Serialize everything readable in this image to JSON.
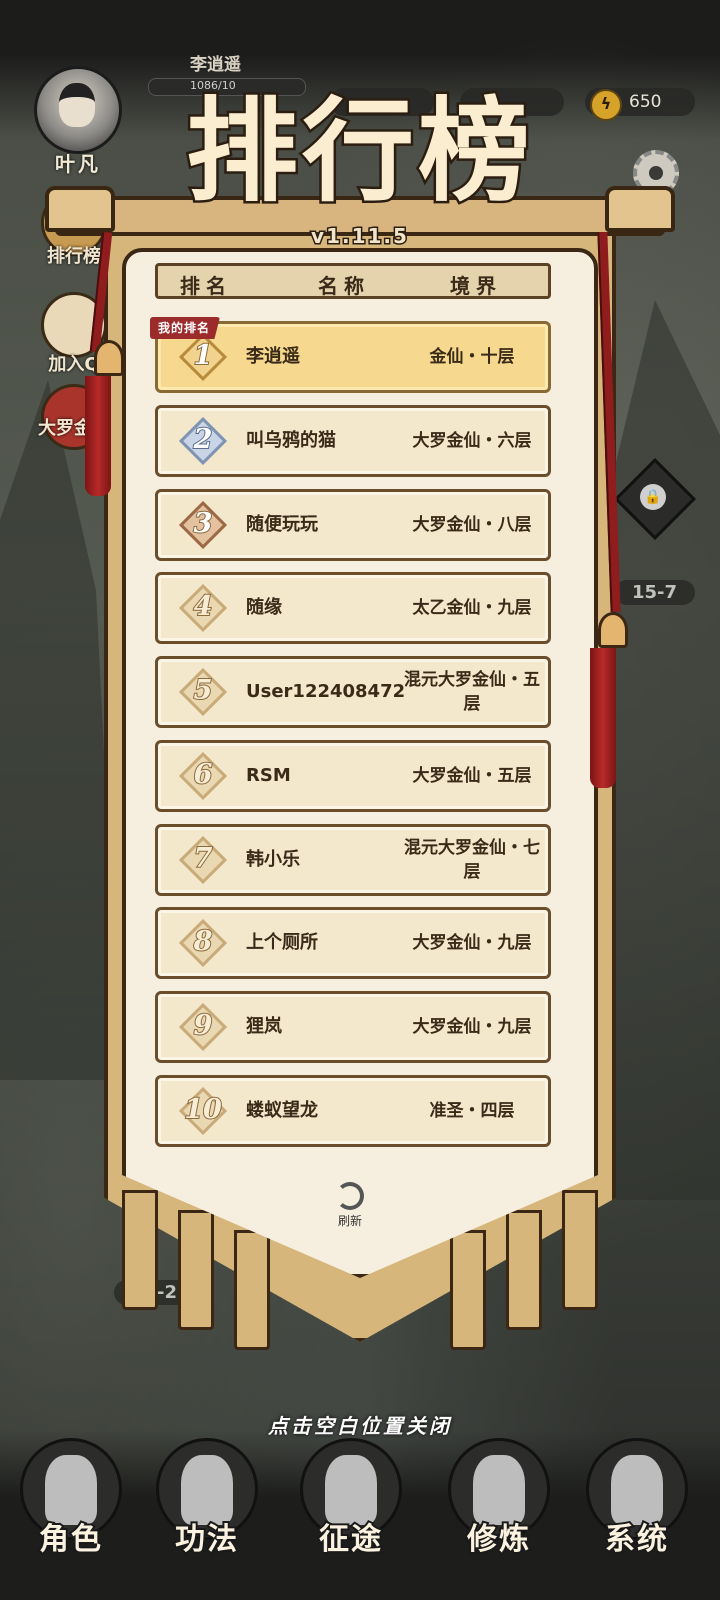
{
  "player": {
    "avatar_name": "叶凡",
    "name": "李逍遥",
    "exp_text": "1086/10",
    "energy": "650"
  },
  "side_buttons": [
    "排行榜",
    "加入Q",
    "大罗金礼"
  ],
  "stages": {
    "right": "15-7",
    "left": "15-2"
  },
  "leaderboard": {
    "title": "排行榜",
    "version": "v1.11.5",
    "headers": {
      "rank": "排名",
      "name": "名称",
      "realm": "境界"
    },
    "my_rank_tag": "我的排名",
    "my_row": {
      "rank": "1",
      "name": "李逍遥",
      "realm": "金仙・十层"
    },
    "rows": [
      {
        "rank": "2",
        "name": "叫乌鸦的猫",
        "realm": "大罗金仙・六层"
      },
      {
        "rank": "3",
        "name": "随便玩玩",
        "realm": "大罗金仙・八层"
      },
      {
        "rank": "4",
        "name": "随缘",
        "realm": "太乙金仙・九层"
      },
      {
        "rank": "5",
        "name": "User122408472",
        "realm": "混元大罗金仙・五层"
      },
      {
        "rank": "6",
        "name": "RSM",
        "realm": "大罗金仙・五层"
      },
      {
        "rank": "7",
        "name": "韩小乐",
        "realm": "混元大罗金仙・七层"
      },
      {
        "rank": "8",
        "name": "上个厕所",
        "realm": "大罗金仙・九层"
      },
      {
        "rank": "9",
        "name": "狸岚",
        "realm": "大罗金仙・九层"
      },
      {
        "rank": "10",
        "name": "蝼蚁望龙",
        "realm": "准圣・四层"
      }
    ],
    "refresh_label": "刷新"
  },
  "close_hint": "点击空白位置关闭",
  "nav": [
    {
      "label": "角色",
      "icon": "character-icon"
    },
    {
      "label": "功法",
      "icon": "scroll-book-icon"
    },
    {
      "label": "征途",
      "icon": "sword-icon"
    },
    {
      "label": "修炼",
      "icon": "meditation-icon"
    },
    {
      "label": "系统",
      "icon": "system-avatar-icon"
    }
  ],
  "colors": {
    "banner": "#d7b67c",
    "panel": "#f6efe0",
    "highlight_row": "#f6d98f",
    "tag_red": "#9c2c2c",
    "tassel_red": "#8f1d1d"
  }
}
